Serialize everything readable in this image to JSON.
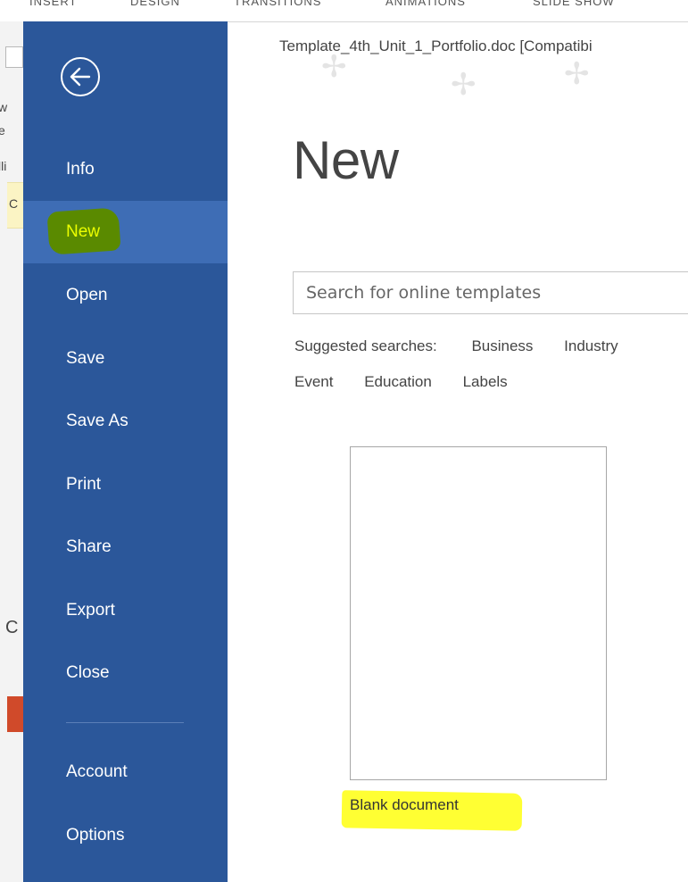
{
  "background_app": {
    "ribbon_tabs": [
      "INSERT",
      "DESIGN",
      "TRANSITIONS",
      "ANIMATIONS",
      "SLIDE SHOW"
    ],
    "left_fragments": [
      "w",
      "e",
      "lli",
      "C",
      "C"
    ]
  },
  "backstage": {
    "back_button": "back-arrow-icon",
    "nav": {
      "info": "Info",
      "new": "New",
      "open": "Open",
      "save": "Save",
      "save_as": "Save As",
      "print": "Print",
      "share": "Share",
      "export": "Export",
      "close": "Close",
      "account": "Account",
      "options": "Options"
    },
    "active_item": "New"
  },
  "main": {
    "document_title": "Template_4th_Unit_1_Portfolio.doc [Compatibi",
    "page_title": "New",
    "search": {
      "placeholder": "Search for online templates",
      "value": ""
    },
    "suggested": {
      "label": "Suggested searches:",
      "items": [
        "Business",
        "Industry",
        "Event",
        "Education",
        "Labels"
      ]
    },
    "templates": [
      {
        "label": "Blank document"
      }
    ]
  },
  "colors": {
    "sidebar": "#2b579a",
    "active_item": "#3e6db5",
    "green_highlight": "#5a8a00",
    "yellow_highlight": "#ffff33"
  }
}
